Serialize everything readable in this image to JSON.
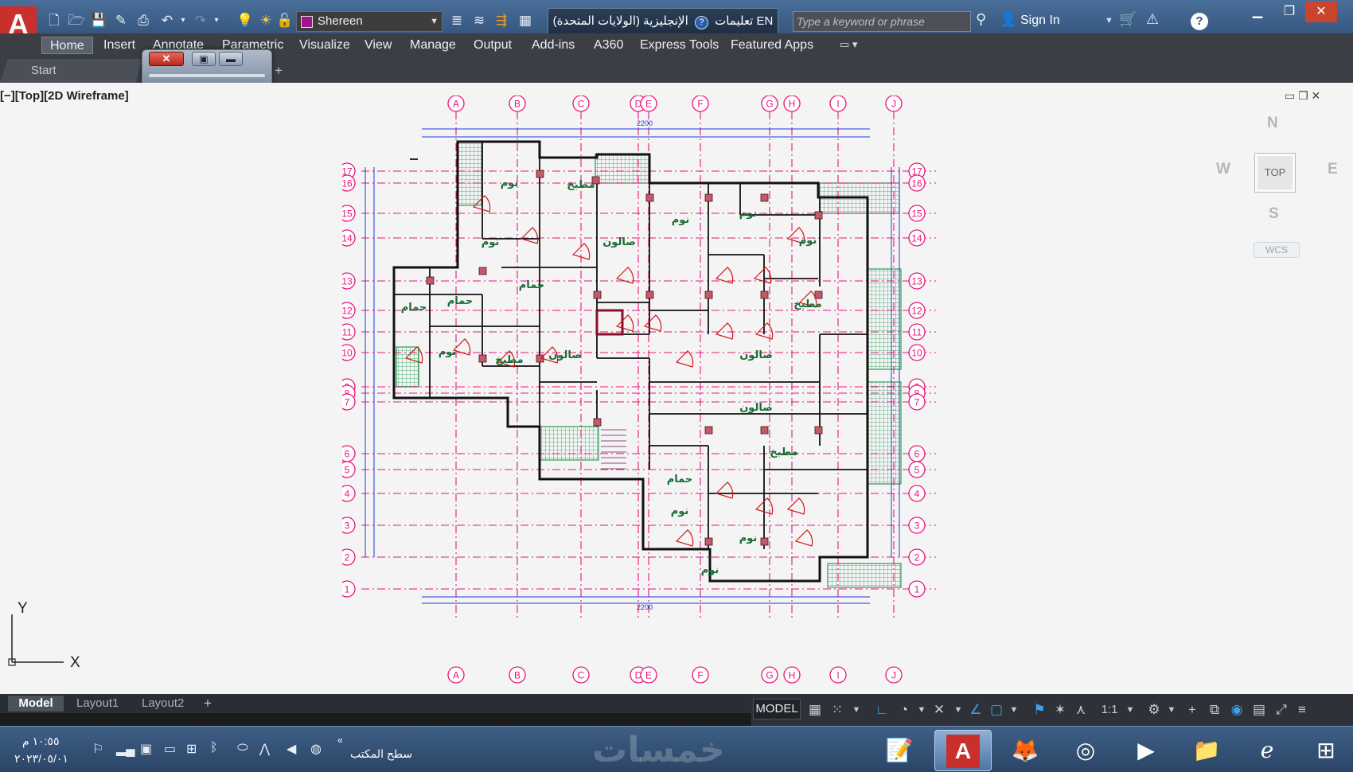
{
  "titlebar": {
    "workspace": "Shereen",
    "title_left": "تعليمات",
    "title_right": "الإنجليزية (الولايات المتحدة) EN",
    "search_placeholder": "Type a keyword or phrase",
    "sign_in": "Sign In",
    "help_symbol": "?"
  },
  "ribbon": {
    "tabs": [
      "Home",
      "Insert",
      "Annotate",
      "Parametric",
      "Visualize",
      "View",
      "Manage",
      "Output",
      "Add-ins",
      "A360",
      "Express Tools",
      "Featured Apps"
    ]
  },
  "file_tabs": {
    "start": "Start"
  },
  "viewport": {
    "label": "[−][Top][2D Wireframe]",
    "viewcube": {
      "face": "TOP",
      "north": "N",
      "south": "S",
      "east": "E",
      "west": "W",
      "wcs": "WCS"
    },
    "ucs": {
      "x": "X",
      "y": "Y"
    }
  },
  "plan": {
    "column_grid": [
      "A",
      "B",
      "C",
      "D",
      "E",
      "F",
      "G",
      "H",
      "I",
      "J"
    ],
    "row_grid": [
      "17",
      "16",
      "15",
      "14",
      "13",
      "12",
      "11",
      "10",
      "9",
      "8",
      "7",
      "6",
      "5",
      "4",
      "3",
      "2",
      "1"
    ],
    "overall_dim": "2200",
    "rooms": [
      {
        "label": "نوم"
      },
      {
        "label": "مطبخ"
      },
      {
        "label": "نوم"
      },
      {
        "label": "صالون"
      },
      {
        "label": "نوم"
      },
      {
        "label": "نوم"
      },
      {
        "label": "نوم"
      },
      {
        "label": "حمام"
      },
      {
        "label": "حمام"
      },
      {
        "label": "حمام"
      },
      {
        "label": "مطبخ"
      },
      {
        "label": "نوم"
      },
      {
        "label": "مطبخ"
      },
      {
        "label": "صالون"
      },
      {
        "label": "صالون"
      },
      {
        "label": "صالون"
      },
      {
        "label": "مطبخ"
      },
      {
        "label": "حمام"
      },
      {
        "label": "نوم"
      },
      {
        "label": "نوم"
      },
      {
        "label": "نوم"
      }
    ]
  },
  "layout_tabs": [
    "Model",
    "Layout1",
    "Layout2"
  ],
  "status": {
    "model": "MODEL",
    "scale": "1:1"
  },
  "taskbar": {
    "time": "١٠:٥٥ م",
    "date": "٢٠٢٣/٠٥/٠١",
    "desktop": "سطح المكتب",
    "watermark": "خمسات"
  },
  "colors": {
    "grid": "#e8157a",
    "walls": "#111111",
    "dimension": "#1f3ad6",
    "hatch": "#2f9b58",
    "room_text": "#1b6b35",
    "door": "#d01818"
  }
}
